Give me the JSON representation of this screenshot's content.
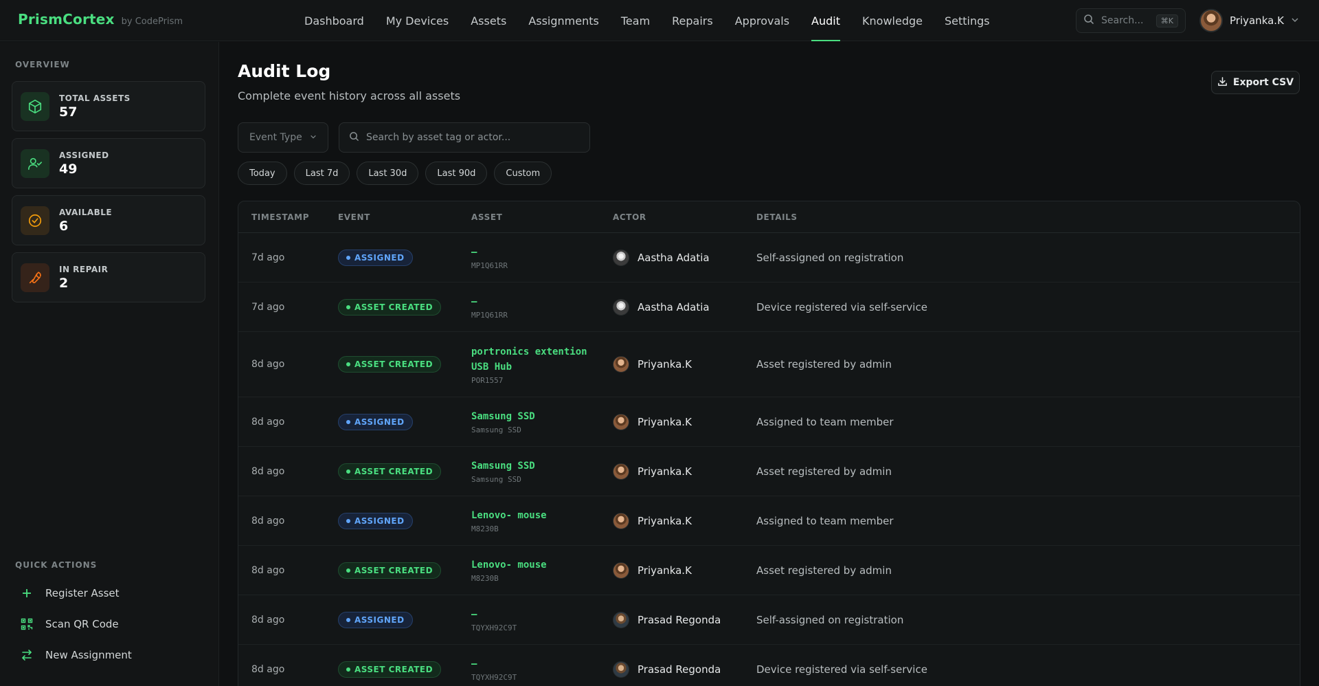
{
  "brand": {
    "name": "PrismCortex",
    "by": "by CodePrism"
  },
  "nav": {
    "items": [
      "Dashboard",
      "My Devices",
      "Assets",
      "Assignments",
      "Team",
      "Repairs",
      "Approvals",
      "Audit",
      "Knowledge",
      "Settings"
    ],
    "active": "Audit"
  },
  "top_search": {
    "placeholder": "Search...",
    "shortcut": "⌘K"
  },
  "user": {
    "name": "Priyanka.K"
  },
  "sidebar": {
    "overview_heading": "OVERVIEW",
    "stats": [
      {
        "label": "TOTAL ASSETS",
        "value": "57",
        "icon": "cube-icon",
        "color": "#4ade80"
      },
      {
        "label": "ASSIGNED",
        "value": "49",
        "icon": "user-check-icon",
        "color": "#4ade80"
      },
      {
        "label": "AVAILABLE",
        "value": "6",
        "icon": "check-circle-icon",
        "color": "#f59e0b"
      },
      {
        "label": "IN REPAIR",
        "value": "2",
        "icon": "wrench-icon",
        "color": "#f97316"
      }
    ],
    "quick_actions_heading": "QUICK ACTIONS",
    "quick_actions": [
      {
        "label": "Register Asset",
        "icon": "plus-icon"
      },
      {
        "label": "Scan QR Code",
        "icon": "qr-code-icon"
      },
      {
        "label": "New Assignment",
        "icon": "swap-icon"
      }
    ]
  },
  "page": {
    "title": "Audit Log",
    "subtitle": "Complete event history across all assets",
    "export_label": "Export CSV"
  },
  "filters": {
    "event_type_label": "Event Type",
    "search_placeholder": "Search by asset tag or actor...",
    "ranges": [
      "Today",
      "Last 7d",
      "Last 30d",
      "Last 90d",
      "Custom"
    ]
  },
  "table": {
    "columns": [
      "TIMESTAMP",
      "EVENT",
      "ASSET",
      "ACTOR",
      "DETAILS"
    ],
    "rows": [
      {
        "ts": "7d ago",
        "event": "ASSIGNED",
        "kind": "assigned",
        "asset": "–",
        "tag": "MP1Q61RR",
        "actor": "Aastha Adatia",
        "details": "Self-assigned on registration"
      },
      {
        "ts": "7d ago",
        "event": "ASSET CREATED",
        "kind": "created",
        "asset": "–",
        "tag": "MP1Q61RR",
        "actor": "Aastha Adatia",
        "details": "Device registered via self-service"
      },
      {
        "ts": "8d ago",
        "event": "ASSET CREATED",
        "kind": "created",
        "asset": "portronics extention USB Hub",
        "tag": "POR1557",
        "actor": "Priyanka.K",
        "details": "Asset registered by admin"
      },
      {
        "ts": "8d ago",
        "event": "ASSIGNED",
        "kind": "assigned",
        "asset": "Samsung SSD",
        "tag": "Samsung SSD",
        "actor": "Priyanka.K",
        "details": "Assigned to team member"
      },
      {
        "ts": "8d ago",
        "event": "ASSET CREATED",
        "kind": "created",
        "asset": "Samsung SSD",
        "tag": "Samsung SSD",
        "actor": "Priyanka.K",
        "details": "Asset registered by admin"
      },
      {
        "ts": "8d ago",
        "event": "ASSIGNED",
        "kind": "assigned",
        "asset": "Lenovo- mouse",
        "tag": "M8230B",
        "actor": "Priyanka.K",
        "details": "Assigned to team member"
      },
      {
        "ts": "8d ago",
        "event": "ASSET CREATED",
        "kind": "created",
        "asset": "Lenovo- mouse",
        "tag": "M8230B",
        "actor": "Priyanka.K",
        "details": "Asset registered by admin"
      },
      {
        "ts": "8d ago",
        "event": "ASSIGNED",
        "kind": "assigned",
        "asset": "–",
        "tag": "TQYXH92C9T",
        "actor": "Prasad Regonda",
        "details": "Self-assigned on registration"
      },
      {
        "ts": "8d ago",
        "event": "ASSET CREATED",
        "kind": "created",
        "asset": "–",
        "tag": "TQYXH92C9T",
        "actor": "Prasad Regonda",
        "details": "Device registered via self-service"
      }
    ]
  }
}
